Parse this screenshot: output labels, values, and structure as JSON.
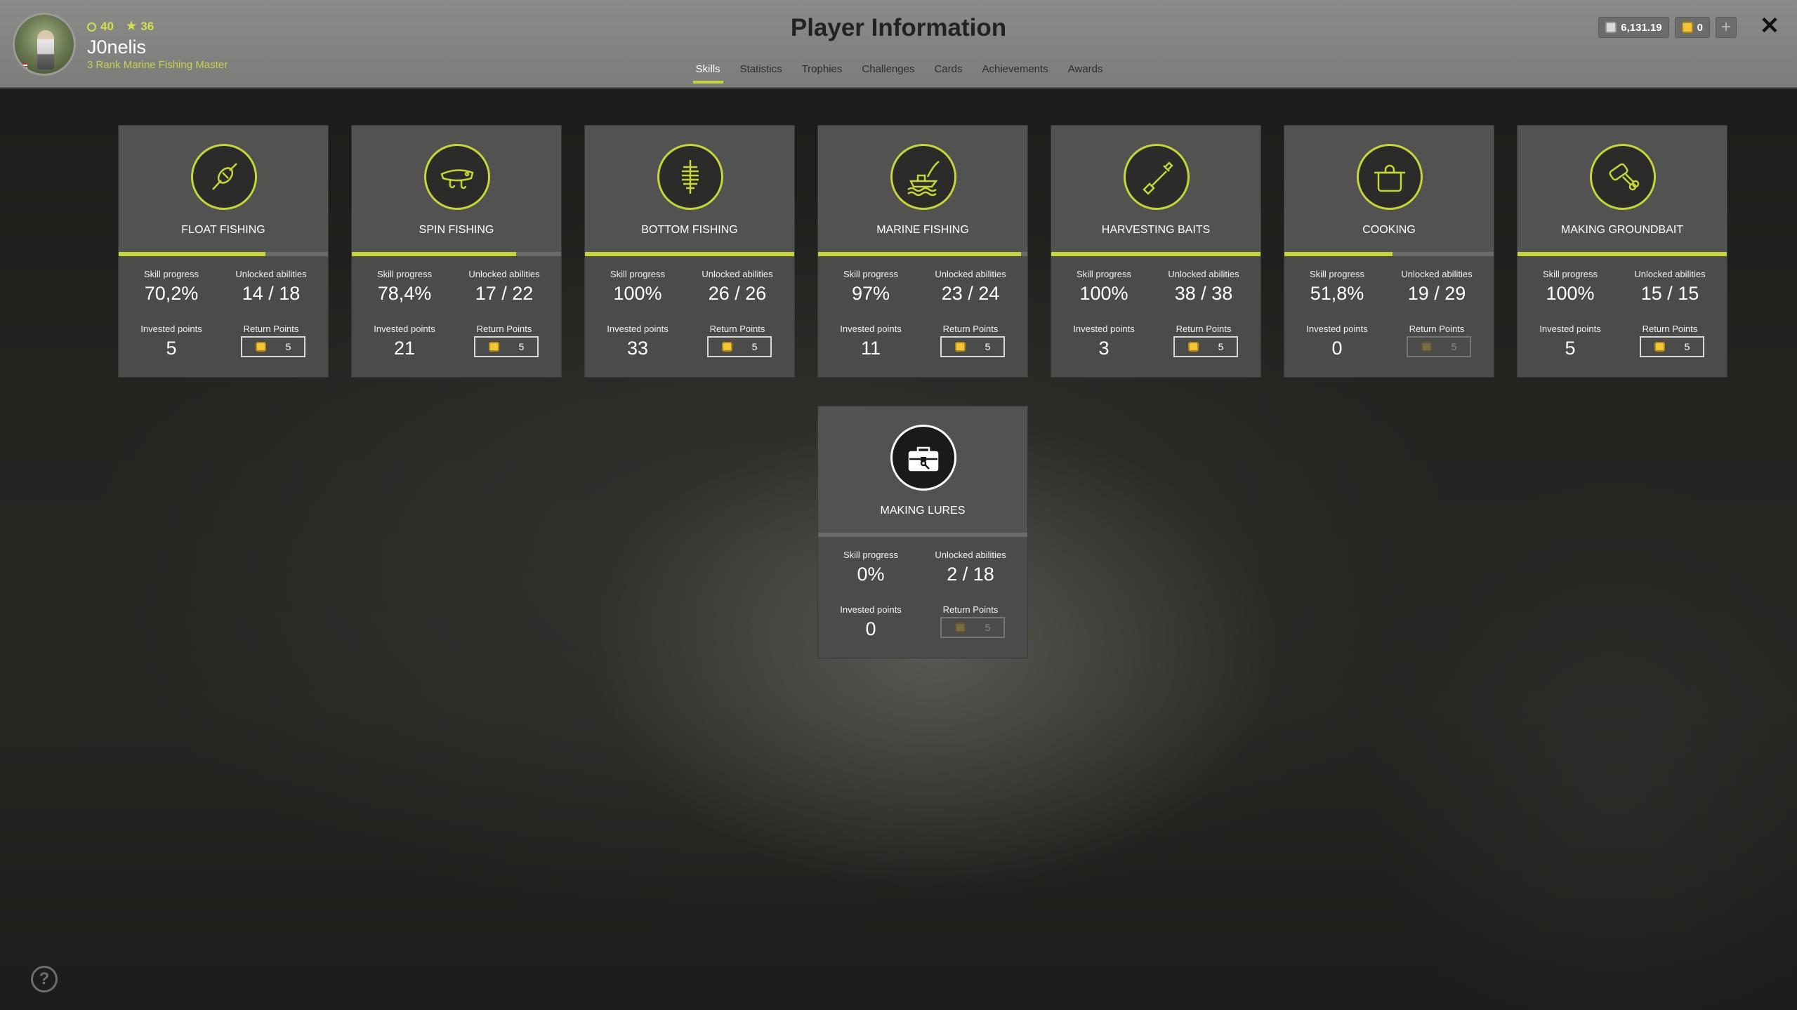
{
  "header": {
    "title": "Player Information",
    "player": {
      "level": "40",
      "stars": "36",
      "name": "J0nelis",
      "rank": "3 Rank Marine Fishing Master"
    },
    "tabs": [
      {
        "label": "Skills",
        "active": true
      },
      {
        "label": "Statistics",
        "active": false
      },
      {
        "label": "Trophies",
        "active": false
      },
      {
        "label": "Challenges",
        "active": false
      },
      {
        "label": "Cards",
        "active": false
      },
      {
        "label": "Achievements",
        "active": false
      },
      {
        "label": "Awards",
        "active": false
      }
    ],
    "currency": {
      "silver": "6,131.19",
      "gold": "0",
      "add_label": "+"
    },
    "close_label": "✕"
  },
  "labels": {
    "skill_progress": "Skill progress",
    "unlocked_abilities": "Unlocked abilities",
    "invested_points": "Invested points",
    "return_points": "Return Points"
  },
  "skills": [
    {
      "name": "FLOAT FISHING",
      "icon": "float-icon",
      "progress": "70,2%",
      "progress_value": 70.2,
      "abilities": "14 / 18",
      "invested": "5",
      "return": "5",
      "return_enabled": true
    },
    {
      "name": "SPIN FISHING",
      "icon": "lure-icon",
      "progress": "78,4%",
      "progress_value": 78.4,
      "abilities": "17 / 22",
      "invested": "21",
      "return": "5",
      "return_enabled": true
    },
    {
      "name": "BOTTOM FISHING",
      "icon": "feeder-icon",
      "progress": "100%",
      "progress_value": 100,
      "abilities": "26 / 26",
      "invested": "33",
      "return": "5",
      "return_enabled": true
    },
    {
      "name": "MARINE FISHING",
      "icon": "boat-icon",
      "progress": "97%",
      "progress_value": 97,
      "abilities": "23 / 24",
      "invested": "11",
      "return": "5",
      "return_enabled": true
    },
    {
      "name": "HARVESTING BAITS",
      "icon": "shovel-icon",
      "progress": "100%",
      "progress_value": 100,
      "abilities": "38 / 38",
      "invested": "3",
      "return": "5",
      "return_enabled": true
    },
    {
      "name": "COOKING",
      "icon": "pot-icon",
      "progress": "51,8%",
      "progress_value": 51.8,
      "abilities": "19 / 29",
      "invested": "0",
      "return": "5",
      "return_enabled": false
    },
    {
      "name": "MAKING GROUNDBAIT",
      "icon": "mixer-icon",
      "progress": "100%",
      "progress_value": 100,
      "abilities": "15 / 15",
      "invested": "5",
      "return": "5",
      "return_enabled": true
    },
    {
      "name": "MAKING LURES",
      "icon": "toolbox-icon",
      "progress": "0%",
      "progress_value": 0,
      "abilities": "2 / 18",
      "invested": "0",
      "return": "5",
      "return_enabled": false
    }
  ],
  "help_label": "?"
}
